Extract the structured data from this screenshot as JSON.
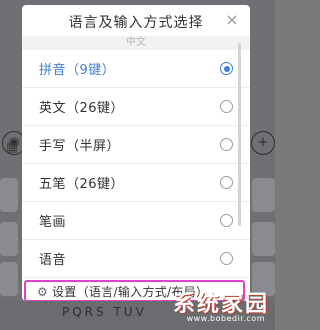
{
  "dialog": {
    "title": "语言及输入方式选择",
    "close_icon_glyph": "×",
    "section_label": "中文",
    "items": [
      {
        "label": "拼音（9键）",
        "selected": true
      },
      {
        "label": "英文（26键）",
        "selected": false
      },
      {
        "label": "手写（半屏）",
        "selected": false
      },
      {
        "label": "五笔（26键）",
        "selected": false
      },
      {
        "label": "笔画",
        "selected": false
      },
      {
        "label": "语音",
        "selected": false
      }
    ],
    "settings": {
      "icon": "gear-icon",
      "icon_glyph": "⚙",
      "label": "设置（语言/输入方式/布局）"
    }
  },
  "background_keyboard": {
    "bottom_row_text": "PQRS TUV"
  },
  "watermark": {
    "main": "系统家园",
    "sub": "www.bobedir.com"
  },
  "colors": {
    "accent": "#3d7ed8",
    "highlight_border": "#e043c7",
    "overlay": "#6f7073"
  }
}
